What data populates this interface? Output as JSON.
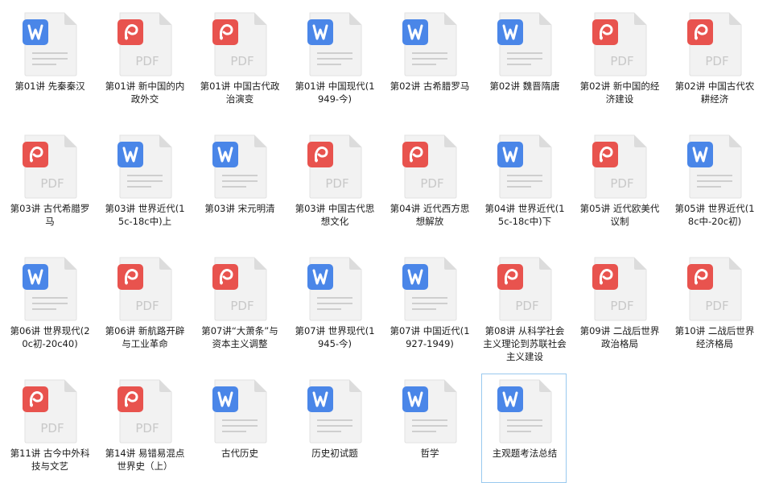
{
  "colors": {
    "word": "#4a86e8",
    "pdf": "#e8534e",
    "page": "#f2f2f2",
    "fold": "#dcdcdc",
    "lines": "#cfcfcf",
    "pdf_text": "#c8c8c8",
    "selection_border": "#99c9ef"
  },
  "pdf_badge_text": "PDF",
  "files": [
    {
      "type": "word",
      "icon": "word-doc-icon",
      "label": "第01讲 先秦秦汉"
    },
    {
      "type": "pdf",
      "icon": "pdf-doc-icon",
      "label": "第01讲 新中国的内政外交"
    },
    {
      "type": "pdf",
      "icon": "pdf-doc-icon",
      "label": "第01讲 中国古代政治演变"
    },
    {
      "type": "word",
      "icon": "word-doc-icon",
      "label": "第01讲 中国现代(1949-今)"
    },
    {
      "type": "word",
      "icon": "word-doc-icon",
      "label": "第02讲 古希腊罗马"
    },
    {
      "type": "word",
      "icon": "word-doc-icon",
      "label": "第02讲 魏晋隋唐"
    },
    {
      "type": "pdf",
      "icon": "pdf-doc-icon",
      "label": "第02讲 新中国的经济建设"
    },
    {
      "type": "pdf",
      "icon": "pdf-doc-icon",
      "label": "第02讲 中国古代农耕经济"
    },
    {
      "type": "pdf",
      "icon": "pdf-doc-icon",
      "label": "第03讲 古代希腊罗马"
    },
    {
      "type": "word",
      "icon": "word-doc-icon",
      "label": "第03讲 世界近代(15c-18c中)上"
    },
    {
      "type": "word",
      "icon": "word-doc-icon",
      "label": "第03讲 宋元明清"
    },
    {
      "type": "pdf",
      "icon": "pdf-doc-icon",
      "label": "第03讲 中国古代思想文化"
    },
    {
      "type": "pdf",
      "icon": "pdf-doc-icon",
      "label": "第04讲 近代西方思想解放"
    },
    {
      "type": "word",
      "icon": "word-doc-icon",
      "label": "第04讲 世界近代(15c-18c中)下"
    },
    {
      "type": "pdf",
      "icon": "pdf-doc-icon",
      "label": "第05讲 近代欧美代议制"
    },
    {
      "type": "word",
      "icon": "word-doc-icon",
      "label": "第05讲 世界近代(18c中-20c初)"
    },
    {
      "type": "word",
      "icon": "word-doc-icon",
      "label": "第06讲 世界现代(20c初-20c40)"
    },
    {
      "type": "pdf",
      "icon": "pdf-doc-icon",
      "label": "第06讲 新航路开辟与工业革命"
    },
    {
      "type": "pdf",
      "icon": "pdf-doc-icon",
      "label": "第07讲“大萧条”与资本主义调整"
    },
    {
      "type": "word",
      "icon": "word-doc-icon",
      "label": "第07讲 世界现代(1945-今)"
    },
    {
      "type": "word",
      "icon": "word-doc-icon",
      "label": "第07讲 中国近代(1927-1949)"
    },
    {
      "type": "pdf",
      "icon": "pdf-doc-icon",
      "label": "第08讲 从科学社会主义理论到苏联社会主义建设"
    },
    {
      "type": "pdf",
      "icon": "pdf-doc-icon",
      "label": "第09讲 二战后世界政治格局"
    },
    {
      "type": "pdf",
      "icon": "pdf-doc-icon",
      "label": "第10讲 二战后世界经济格局"
    },
    {
      "type": "pdf",
      "icon": "pdf-doc-icon",
      "label": "第11讲 古今中外科技与文艺"
    },
    {
      "type": "pdf",
      "icon": "pdf-doc-icon",
      "label": "第14讲 易错易混点世界史（上）"
    },
    {
      "type": "word",
      "icon": "word-doc-icon",
      "label": "古代历史"
    },
    {
      "type": "word",
      "icon": "word-doc-icon",
      "label": "历史初试题"
    },
    {
      "type": "word",
      "icon": "word-doc-icon",
      "label": "哲学"
    },
    {
      "type": "word",
      "icon": "word-doc-icon",
      "label": "主观题考法总结",
      "selected": true
    }
  ]
}
